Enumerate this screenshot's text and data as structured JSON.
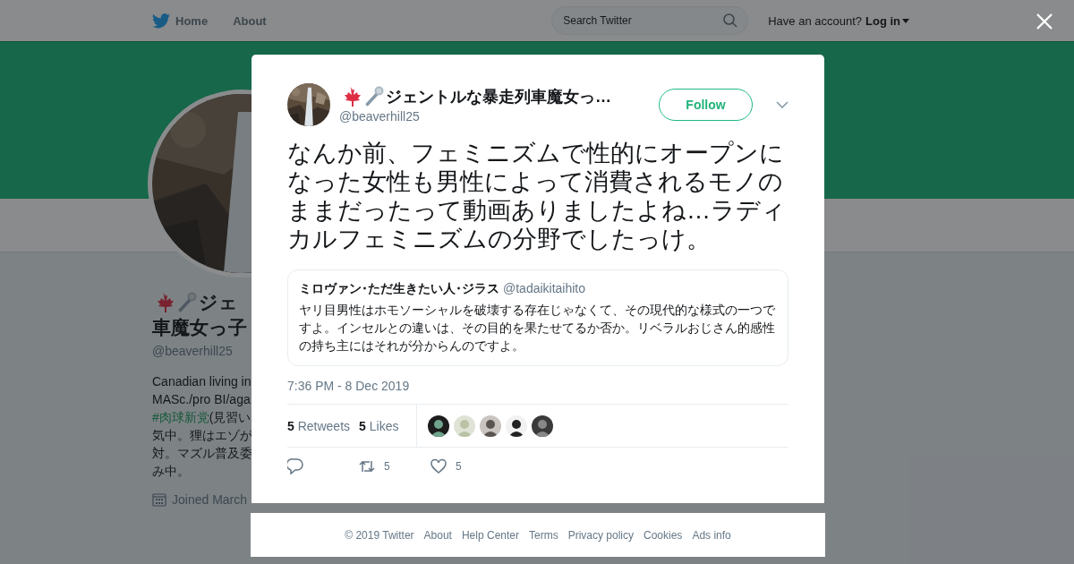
{
  "topbar": {
    "nav": [
      {
        "label": "Home",
        "kind": "home"
      },
      {
        "label": "About",
        "kind": "plain"
      }
    ],
    "search": {
      "placeholder": "Search Twitter"
    },
    "account_prompt": "Have an account?",
    "login": "Log in"
  },
  "profile": {
    "name_lines": [
      "ジェ",
      "車魔女っ子"
    ],
    "handle": "@beaverhill25",
    "bio_lines": [
      [
        {
          "kind": "text",
          "text": "Canadian living in"
        }
      ],
      [
        {
          "kind": "text",
          "text": "MASc./pro BI/aga"
        }
      ],
      [
        {
          "kind": "hashtag",
          "text": "#肉球新党"
        },
        {
          "kind": "text",
          "text": "(見習い"
        }
      ],
      [
        {
          "kind": "text",
          "text": "気中。狸はエゾが"
        }
      ],
      [
        {
          "kind": "text",
          "text": "対。マズル普及委"
        }
      ],
      [
        {
          "kind": "text",
          "text": "み中。"
        }
      ]
    ],
    "joined": "Joined March"
  },
  "tweet": {
    "author": {
      "name": "ジェントルな暴走列車魔女っ…",
      "handle": "@beaverhill25"
    },
    "follow_button": "Follow",
    "text": "なんか前、フェミニズムで性的にオープンになった女性も男性によって消費されるモノのままだったって動画ありましたよね…ラディカルフェミニズムの分野でしたっけ。",
    "quoted": {
      "name": "ミロヴァン･ただ生きたい人･ジラス",
      "handle": "@tadaikitaihito",
      "text": "ヤリ目男性はホモソーシャルを破壊する存在じゃなくて、その現代的な様式の一つですよ。インセルとの違いは、その目的を果たせてるか否か。リベラルおじさん的感性の持ち主にはそれが分からんのですよ。"
    },
    "timestamp": "7:36 PM - 8 Dec 2019",
    "stats": [
      {
        "count": "5",
        "label": "Retweets"
      },
      {
        "count": "5",
        "label": "Likes"
      }
    ],
    "actions": [
      {
        "kind": "reply"
      },
      {
        "kind": "retweet",
        "count": "5"
      },
      {
        "kind": "like",
        "count": "5"
      }
    ]
  },
  "footer": [
    "© 2019 Twitter",
    "About",
    "Help Center",
    "Terms",
    "Privacy policy",
    "Cookies",
    "Ads info"
  ]
}
